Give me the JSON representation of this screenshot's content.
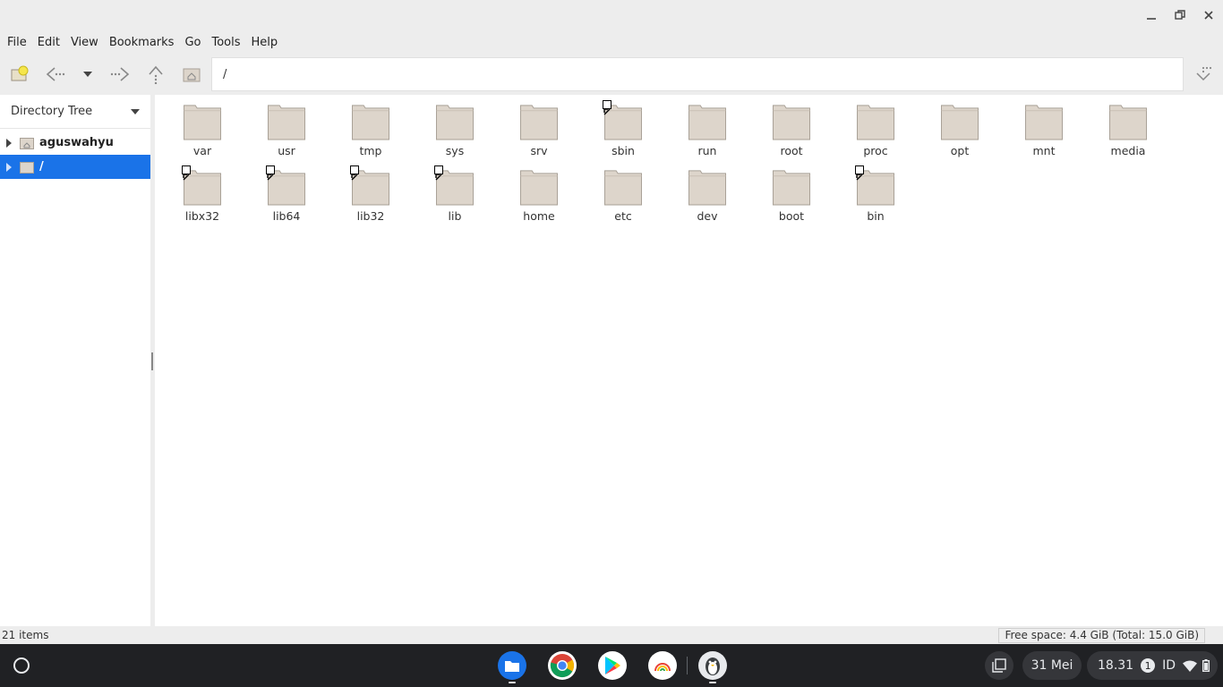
{
  "menu": [
    "File",
    "Edit",
    "View",
    "Bookmarks",
    "Go",
    "Tools",
    "Help"
  ],
  "address": {
    "path": "/"
  },
  "sidebar": {
    "header": "Directory Tree",
    "items": [
      {
        "label": "aguswahyu",
        "icon": "home-folder-icon"
      },
      {
        "label": "/",
        "icon": "folder-icon"
      }
    ]
  },
  "files": [
    {
      "name": "var",
      "link": false
    },
    {
      "name": "usr",
      "link": false
    },
    {
      "name": "tmp",
      "link": false
    },
    {
      "name": "sys",
      "link": false
    },
    {
      "name": "srv",
      "link": false
    },
    {
      "name": "sbin",
      "link": true
    },
    {
      "name": "run",
      "link": false
    },
    {
      "name": "root",
      "link": false
    },
    {
      "name": "proc",
      "link": false
    },
    {
      "name": "opt",
      "link": false
    },
    {
      "name": "mnt",
      "link": false
    },
    {
      "name": "media",
      "link": false
    },
    {
      "name": "libx32",
      "link": true
    },
    {
      "name": "lib64",
      "link": true
    },
    {
      "name": "lib32",
      "link": true
    },
    {
      "name": "lib",
      "link": true
    },
    {
      "name": "home",
      "link": false
    },
    {
      "name": "etc",
      "link": false
    },
    {
      "name": "dev",
      "link": false
    },
    {
      "name": "boot",
      "link": false
    },
    {
      "name": "bin",
      "link": true
    }
  ],
  "status": {
    "items": "21 items",
    "free_space": "Free space: 4.4 GiB (Total: 15.0 GiB)"
  },
  "shelf": {
    "date": "31 Mei",
    "time": "18.31",
    "notifications": "1",
    "ime": "ID"
  },
  "colors": {
    "selection": "#1a73e8",
    "folder": "#ddd5cb",
    "folder_edge": "#a8a096",
    "shelf": "#202124"
  }
}
